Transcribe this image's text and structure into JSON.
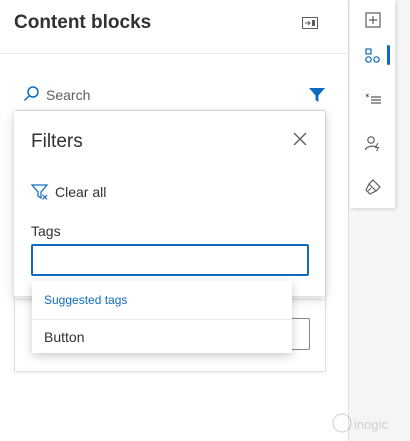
{
  "panel": {
    "title": "Content blocks",
    "search_placeholder": "Search"
  },
  "filters": {
    "title": "Filters",
    "clear_all_label": "Clear all",
    "tags_label": "Tags",
    "tags_value": ""
  },
  "suggestions": {
    "header": "Suggested tags",
    "items": [
      "Button"
    ]
  },
  "rail": {
    "items": [
      "add-section-icon",
      "content-blocks-icon",
      "text-styles-icon",
      "personalization-icon",
      "brush-icon"
    ],
    "active_index": 1
  },
  "colors": {
    "accent": "#0f6cbd",
    "text": "#323130"
  },
  "watermark_text": "inogic"
}
